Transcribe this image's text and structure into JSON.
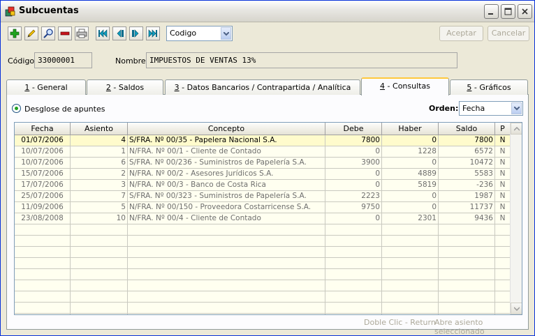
{
  "window": {
    "title": "Subcuentas"
  },
  "toolbar": {
    "buttons": [
      "add-icon",
      "edit-icon",
      "search-icon",
      "delete-icon",
      "print-icon",
      "first-record-icon",
      "previous-record-icon",
      "next-record-icon",
      "last-record-icon"
    ],
    "order_select": "Codigo",
    "accept_label": "Aceptar",
    "cancel_label": "Cancelar"
  },
  "fields": {
    "codigo_label": "Código",
    "codigo_value": "33000001",
    "nombre_label": "Nombre",
    "nombre_value": "IMPUESTOS DE VENTAS 13%"
  },
  "tabs": [
    {
      "key": "1",
      "label": " - General"
    },
    {
      "key": "2",
      "label": " - Saldos"
    },
    {
      "key": "3",
      "label": " - Datos Bancarios / Contrapartida / Analítica"
    },
    {
      "key": "4",
      "label": " - Consultas",
      "active": true
    },
    {
      "key": "5",
      "label": " - Gráficos"
    }
  ],
  "consultas": {
    "radio_label": "Desglose de apuntes",
    "orden_label": "Orden:",
    "orden_value": "Fecha",
    "columns": [
      "Fecha",
      "Asiento",
      "Concepto",
      "Debe",
      "Haber",
      "Saldo",
      "P"
    ],
    "rows": [
      [
        "01/07/2006",
        "4",
        "S/FRA. Nº 00/35 - Papelera Nacional S.A.",
        "7800",
        "0",
        "7800",
        "N"
      ],
      [
        "10/07/2006",
        "1",
        "N/FRA. Nº 00/1 - Cliente de Contado",
        "0",
        "1228",
        "6572",
        "N"
      ],
      [
        "10/07/2006",
        "6",
        "S/FRA. Nº 00/236 - Suministros de Papelería S.A.",
        "3900",
        "0",
        "10472",
        "N"
      ],
      [
        "15/07/2006",
        "2",
        "N/FRA. Nº 00/2 - Asesores Jurídicos S.A.",
        "0",
        "4889",
        "5583",
        "N"
      ],
      [
        "17/07/2006",
        "3",
        "N/FRA. Nº 00/3 - Banco de Costa Rica",
        "0",
        "5819",
        "-236",
        "N"
      ],
      [
        "25/07/2006",
        "7",
        "S/FRA. Nº 00/323 - Suministros de Papelería S.A.",
        "2223",
        "0",
        "1987",
        "N"
      ],
      [
        "11/09/2006",
        "5",
        "N/FRA. Nº 00/150 - Proveedora Costarricense S.A.",
        "9750",
        "0",
        "11737",
        "N"
      ],
      [
        "23/08/2008",
        "10",
        "N/FRA. Nº 00/4 - Cliente de Contado",
        "0",
        "2301",
        "9436",
        "N"
      ]
    ],
    "empty_rows": 10
  },
  "status": {
    "hint_left": "Doble Clic - Return",
    "hint_right": "Abre asiento seleccionado"
  }
}
